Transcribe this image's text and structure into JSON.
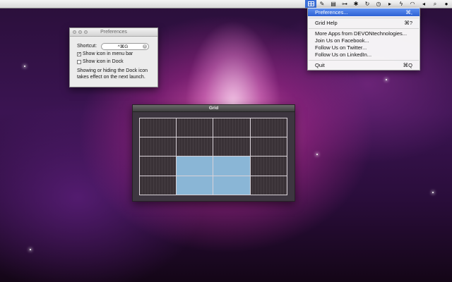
{
  "menubar": {
    "active_item": "grid-menu",
    "icons": [
      "grid-icon",
      "tool-icon",
      "keyboard-icon",
      "remote-icon",
      "bluetooth-icon",
      "sync-icon",
      "time-machine-icon",
      "play-icon",
      "bolt-icon",
      "wifi-icon",
      "volume-icon",
      "spotlight-icon",
      "user-icon"
    ],
    "highlight_color": "#3a6fd8"
  },
  "dropdown": {
    "items": [
      {
        "label": "Preferences...",
        "shortcut": "⌘,",
        "highlighted": true
      },
      {
        "label": "Grid Help",
        "shortcut": "⌘?"
      },
      {
        "label": "More Apps from DEVONtechnologies...",
        "shortcut": ""
      },
      {
        "label": "Join Us on Facebook...",
        "shortcut": ""
      },
      {
        "label": "Follow Us on Twitter...",
        "shortcut": ""
      },
      {
        "label": "Follow Us on LinkedIn...",
        "shortcut": ""
      },
      {
        "label": "Quit",
        "shortcut": "⌘Q"
      }
    ]
  },
  "preferences": {
    "title": "Preferences",
    "shortcut_label": "Shortcut:",
    "shortcut_value": "^⌘G",
    "show_menu_bar_label": "Show icon in menu bar",
    "show_menu_bar_checked": true,
    "show_menu_bar_mark": "✓",
    "show_dock_label": "Show icon in Dock",
    "show_dock_checked": false,
    "note_line1": "Showing or hiding the Dock icon",
    "note_line2": "takes effect on the next launch."
  },
  "grid_window": {
    "title": "Grid",
    "columns": 4,
    "rows": 4,
    "selection_color": "#8ab6d6"
  }
}
